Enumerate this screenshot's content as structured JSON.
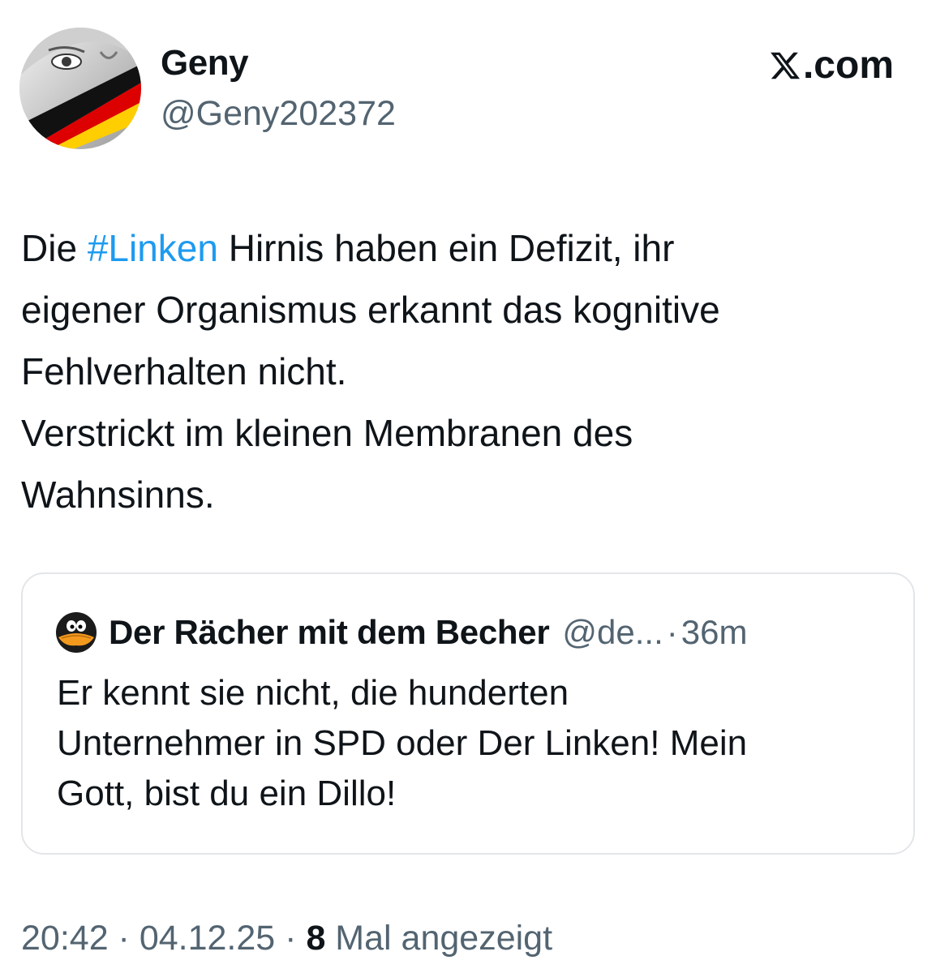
{
  "author": {
    "display_name": "Geny",
    "handle": "@Geny202372"
  },
  "site_badge": {
    "icon": "x-logo-icon",
    "text": ".com"
  },
  "tweet": {
    "text_lines": [
      {
        "before": "Die ",
        "hashtag": "#Linken",
        "after": " Hirnis haben ein Defizit, ihr"
      },
      {
        "text": "eigener Organismus erkannt das kognitive"
      },
      {
        "text": "Fehlverhalten nicht."
      },
      {
        "text": "Verstrickt im kleinen Membranen des"
      },
      {
        "text": "Wahnsinns."
      }
    ]
  },
  "quoted_tweet": {
    "avatar_icon": "daffy-duck-avatar-icon",
    "display_name": "Der Rächer mit dem Becher",
    "handle": "@de...",
    "separator": "·",
    "time": "36m",
    "text_lines": [
      "Er kennt sie nicht, die hunderten",
      "Unternehmer in SPD oder Der Linken! Mein",
      "Gott, bist du ein Dillo!"
    ]
  },
  "meta": {
    "time": "20:42",
    "separator": " · ",
    "date": "04.12.25",
    "views_count": "8",
    "views_label": " Mal angezeigt"
  },
  "colors": {
    "hashtag": "#1d9bf0",
    "secondary_text": "#536471",
    "primary_text": "#0f1419",
    "card_border": "#e3e6e9",
    "flag_black": "#111111",
    "flag_red": "#dd0000",
    "flag_gold": "#ffce00"
  }
}
